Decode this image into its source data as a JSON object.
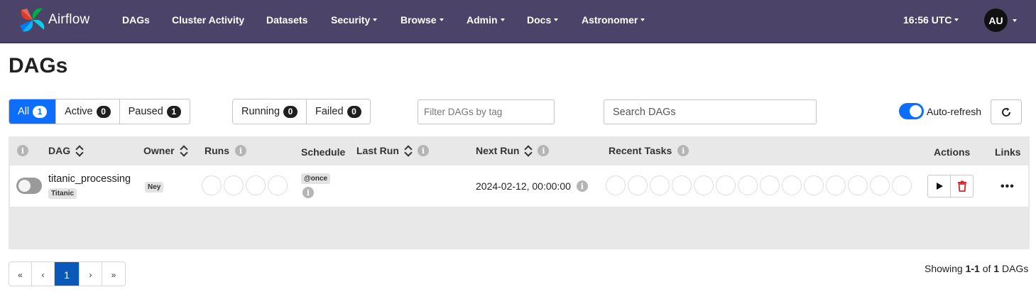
{
  "nav": {
    "brand": "Airflow",
    "items": [
      "DAGs",
      "Cluster Activity",
      "Datasets",
      "Security",
      "Browse",
      "Admin",
      "Docs",
      "Astronomer"
    ],
    "time": "16:56 UTC",
    "user_initials": "AU"
  },
  "page": {
    "title": "DAGs"
  },
  "status_filters": [
    {
      "label": "All",
      "count": "1"
    },
    {
      "label": "Active",
      "count": "0"
    },
    {
      "label": "Paused",
      "count": "1"
    }
  ],
  "run_filters": [
    {
      "label": "Running",
      "count": "0"
    },
    {
      "label": "Failed",
      "count": "0"
    }
  ],
  "tag_filter": {
    "placeholder": "Filter DAGs by tag"
  },
  "search": {
    "placeholder": "Search DAGs"
  },
  "auto_refresh": {
    "label": "Auto-refresh",
    "enabled": true
  },
  "table": {
    "columns": [
      "DAG",
      "Owner",
      "Runs",
      "Schedule",
      "Last Run",
      "Next Run",
      "Recent Tasks",
      "Actions",
      "Links"
    ],
    "rows": [
      {
        "dag_id": "titanic_processing",
        "tag": "Titanic",
        "owner": "Ney",
        "schedule": "@once",
        "last_run": "",
        "next_run": "2024-02-12, 00:00:00",
        "paused": true
      }
    ]
  },
  "pagination": {
    "first": "«",
    "prev": "‹",
    "current": "1",
    "next": "›",
    "last": "»"
  },
  "footer": {
    "showing_prefix": "Showing",
    "range": "1-1",
    "of": "of",
    "total": "1",
    "suffix": "DAGs"
  },
  "colors": {
    "navbar": "#4b4468",
    "accent": "#0d6efd",
    "page_active": "#0a58b7"
  }
}
